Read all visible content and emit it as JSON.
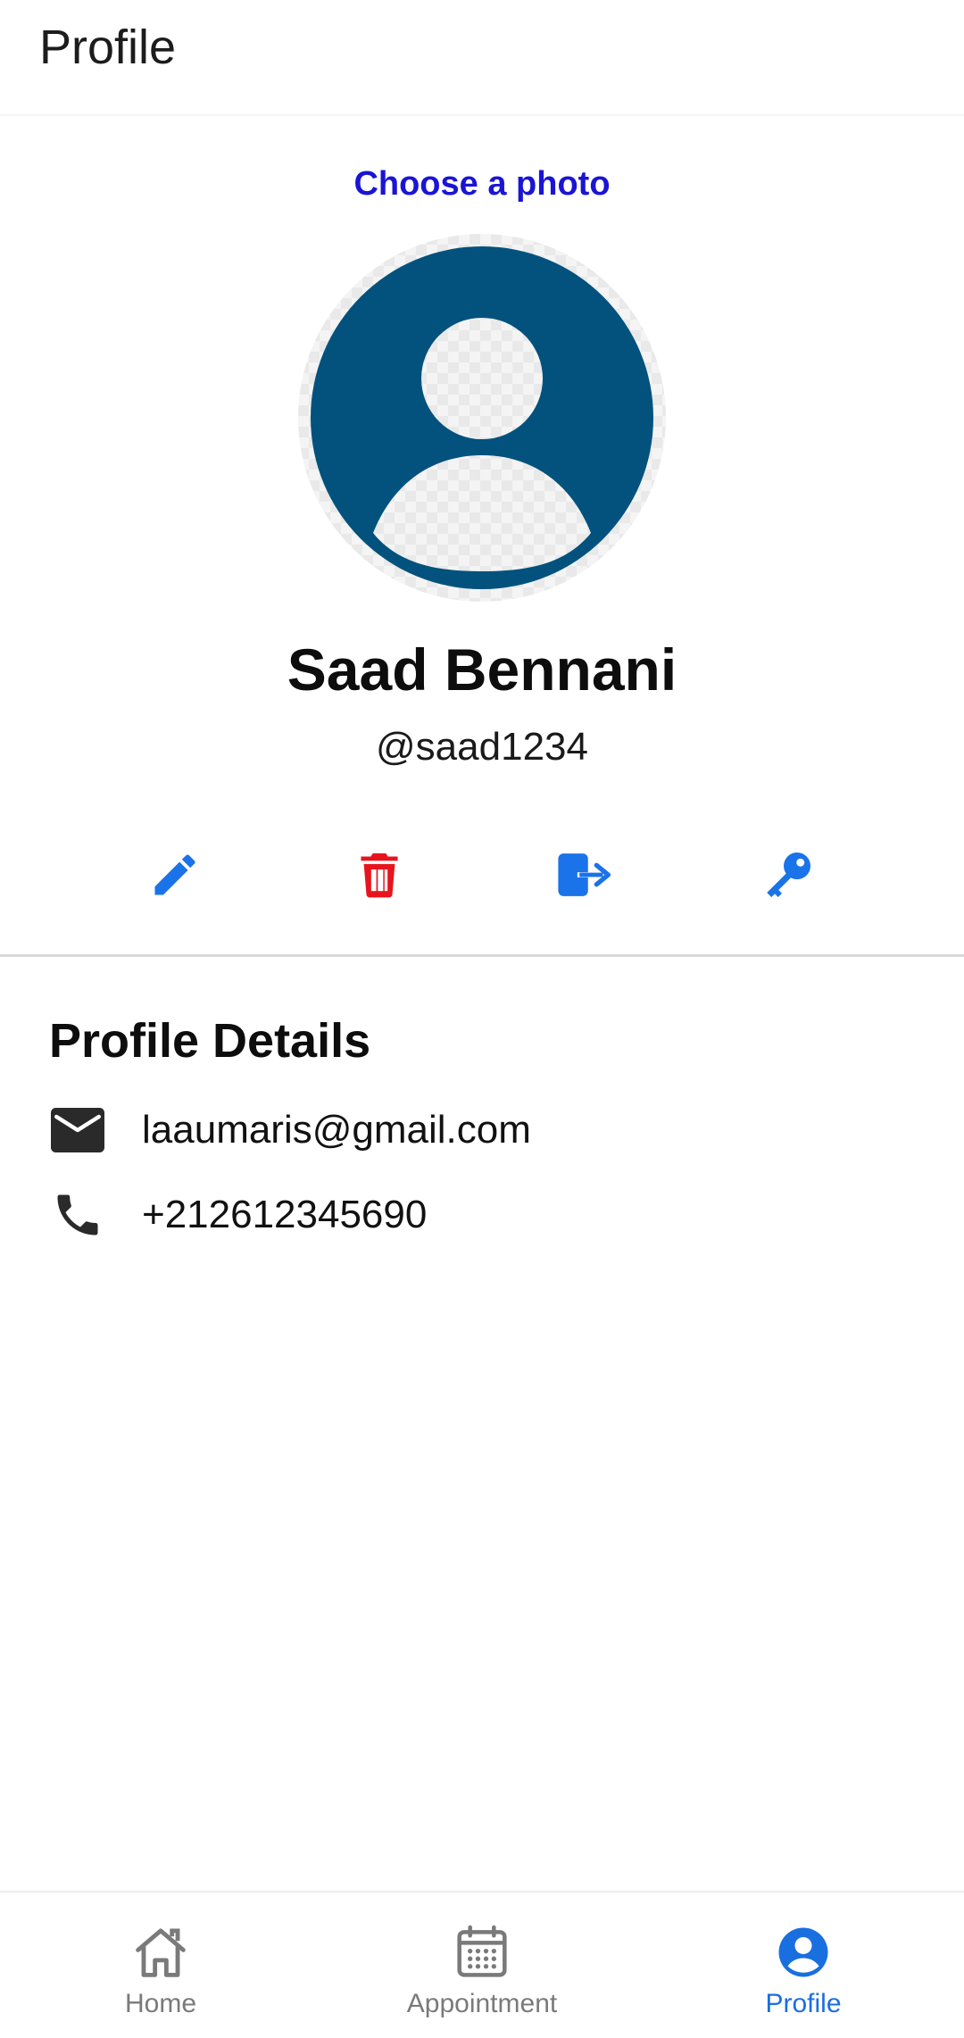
{
  "app_bar": {
    "title": "Profile"
  },
  "profile": {
    "choose_photo_label": "Choose a photo",
    "name": "Saad Bennani",
    "handle": "@saad1234"
  },
  "actions": [
    {
      "icon": "pencil-icon",
      "color": "#1a73e8"
    },
    {
      "icon": "trash-icon",
      "color": "#e8141d"
    },
    {
      "icon": "logout-icon",
      "color": "#1a73e8"
    },
    {
      "icon": "key-icon",
      "color": "#1a73e8"
    }
  ],
  "details": {
    "title": "Profile Details",
    "email": "laaumaris@gmail.com",
    "phone": "+212612345690"
  },
  "bottom_nav": {
    "items": [
      {
        "label": "Home",
        "icon": "home-icon",
        "active": false
      },
      {
        "label": "Appointment",
        "icon": "calendar-icon",
        "active": false
      },
      {
        "label": "Profile",
        "icon": "account-circle-icon",
        "active": true
      }
    ]
  },
  "colors": {
    "avatar": "#03527d",
    "accent": "#1a6fe0",
    "link": "#1a14d4",
    "danger": "#e8141d"
  }
}
